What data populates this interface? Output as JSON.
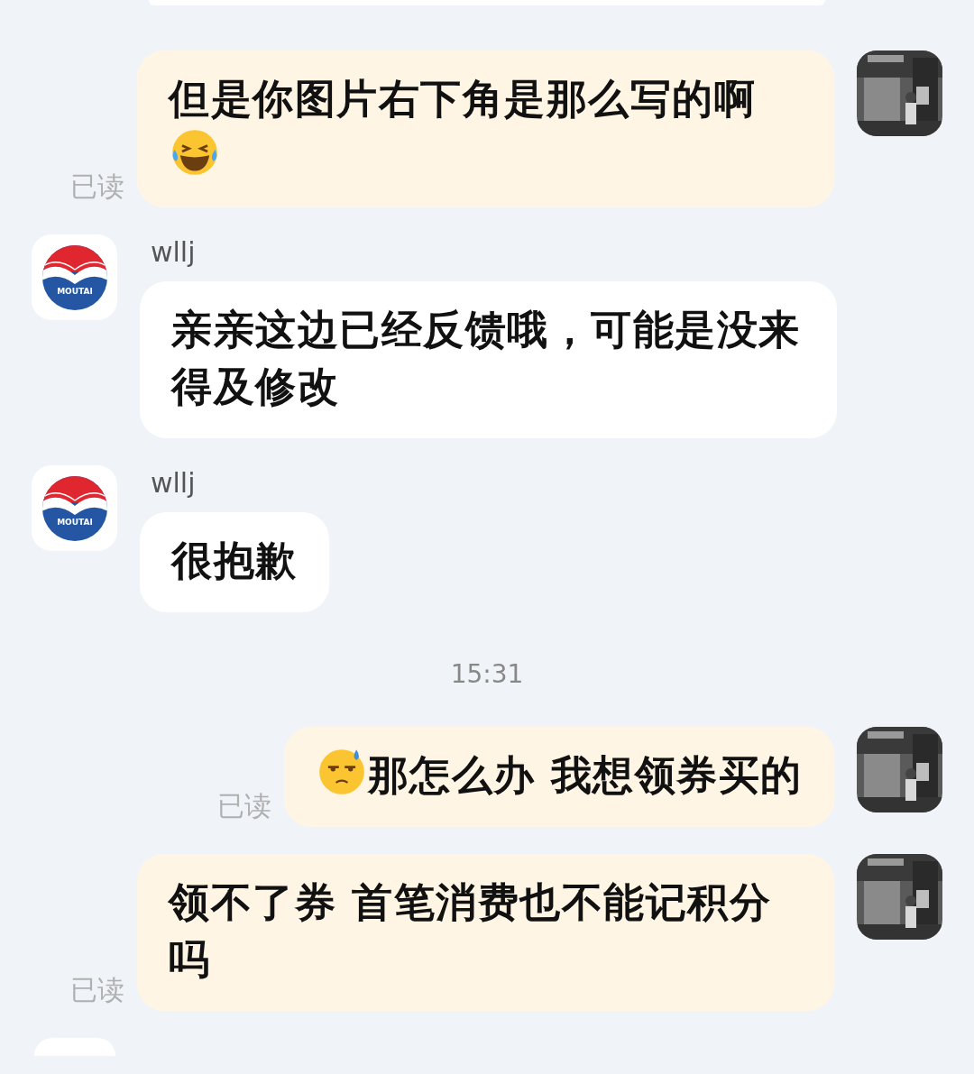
{
  "messages": [
    {
      "kind": "partial-top"
    },
    {
      "kind": "out",
      "read": "已读",
      "segments": [
        {
          "kind": "text",
          "text": "但是你图片右下角是那么写的啊"
        },
        {
          "kind": "emoji-laugh"
        }
      ]
    },
    {
      "kind": "in",
      "sender": "wllj",
      "avatar_label": "MOUTAI",
      "segments": [
        {
          "kind": "text",
          "text": "亲亲这边已经反馈哦，可能是没来得及修改"
        }
      ]
    },
    {
      "kind": "in",
      "sender": "wllj",
      "avatar_label": "MOUTAI",
      "segments": [
        {
          "kind": "text",
          "text": "很抱歉"
        }
      ]
    },
    {
      "kind": "time",
      "text": "15:31"
    },
    {
      "kind": "out",
      "read": "已读",
      "segments": [
        {
          "kind": "emoji-sweat"
        },
        {
          "kind": "text",
          "text": "那怎么办 我想领券买的"
        }
      ]
    },
    {
      "kind": "out",
      "read": "已读",
      "segments": [
        {
          "kind": "text",
          "text": "领不了券 首笔消费也不能记积分吗"
        }
      ]
    },
    {
      "kind": "partial-bottom"
    }
  ]
}
